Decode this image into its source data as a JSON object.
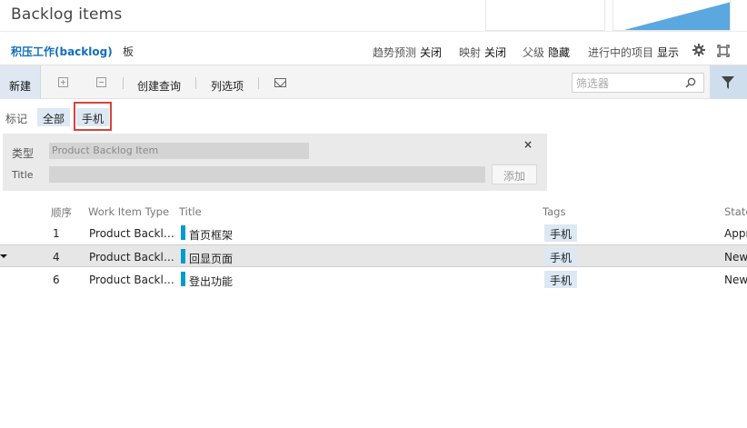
{
  "page": {
    "title": "Backlog items"
  },
  "nav": {
    "backlog": "积压工作(backlog)",
    "board": "板",
    "options": [
      {
        "key": "趋势预测",
        "value": "关闭"
      },
      {
        "key": "映射",
        "value": "关闭"
      },
      {
        "key": "父级",
        "value": "隐藏"
      },
      {
        "key": "进行中的项目",
        "value": "显示"
      }
    ]
  },
  "toolbar": {
    "new_label": "新建",
    "create_query": "创建查询",
    "column_options": "列选项",
    "filter_placeholder": "筛选器"
  },
  "tags_bar": {
    "label": "标记",
    "all": "全部",
    "phone": "手机"
  },
  "quick_add": {
    "type_label": "类型",
    "type_value": "Product Backlog Item",
    "title_label": "Title",
    "add_button": "添加",
    "close": "×"
  },
  "grid": {
    "headers": {
      "order": "顺序",
      "type": "Work Item Type",
      "title": "Title",
      "tags": "Tags",
      "state": "State"
    },
    "rows": [
      {
        "order": "1",
        "type": "Product Backlog Item",
        "title": "首页框架",
        "tag": "手机",
        "state": "Approved"
      },
      {
        "order": "4",
        "type": "Product Backlog Item",
        "title": "回显页面",
        "tag": "手机",
        "state": "New"
      },
      {
        "order": "6",
        "type": "Product Backlog Item",
        "title": "登出功能",
        "tag": "手机",
        "state": "New"
      }
    ]
  },
  "colors": {
    "accent": "#106ebe",
    "selected_row": "#e6e6e6",
    "tag_bg": "#dce8f3",
    "item_color_bar": "#009ccc",
    "highlight_frame": "#d9433b",
    "chart_fill": "#5ba7e0"
  }
}
